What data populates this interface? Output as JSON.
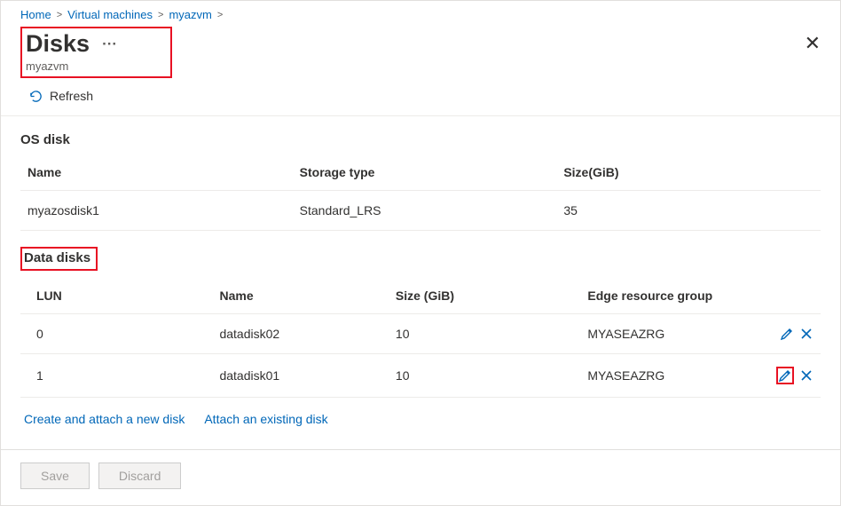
{
  "breadcrumb": {
    "home": "Home",
    "vm": "Virtual machines",
    "resource": "myazvm"
  },
  "title": "Disks",
  "subtitle": "myazvm",
  "refresh": "Refresh",
  "os_section": "OS disk",
  "os_headers": {
    "name": "Name",
    "storage": "Storage type",
    "size": "Size(GiB)"
  },
  "os_row": {
    "name": "myazosdisk1",
    "storage": "Standard_LRS",
    "size": "35"
  },
  "data_section": "Data disks",
  "data_headers": {
    "lun": "LUN",
    "name": "Name",
    "size": "Size (GiB)",
    "erg": "Edge resource group"
  },
  "data_rows": [
    {
      "lun": "0",
      "name": "datadisk02",
      "size": "10",
      "erg": "MYASEAZRG"
    },
    {
      "lun": "1",
      "name": "datadisk01",
      "size": "10",
      "erg": "MYASEAZRG"
    }
  ],
  "links": {
    "create": "Create and attach a new disk",
    "attach": "Attach an existing disk"
  },
  "buttons": {
    "save": "Save",
    "discard": "Discard"
  }
}
